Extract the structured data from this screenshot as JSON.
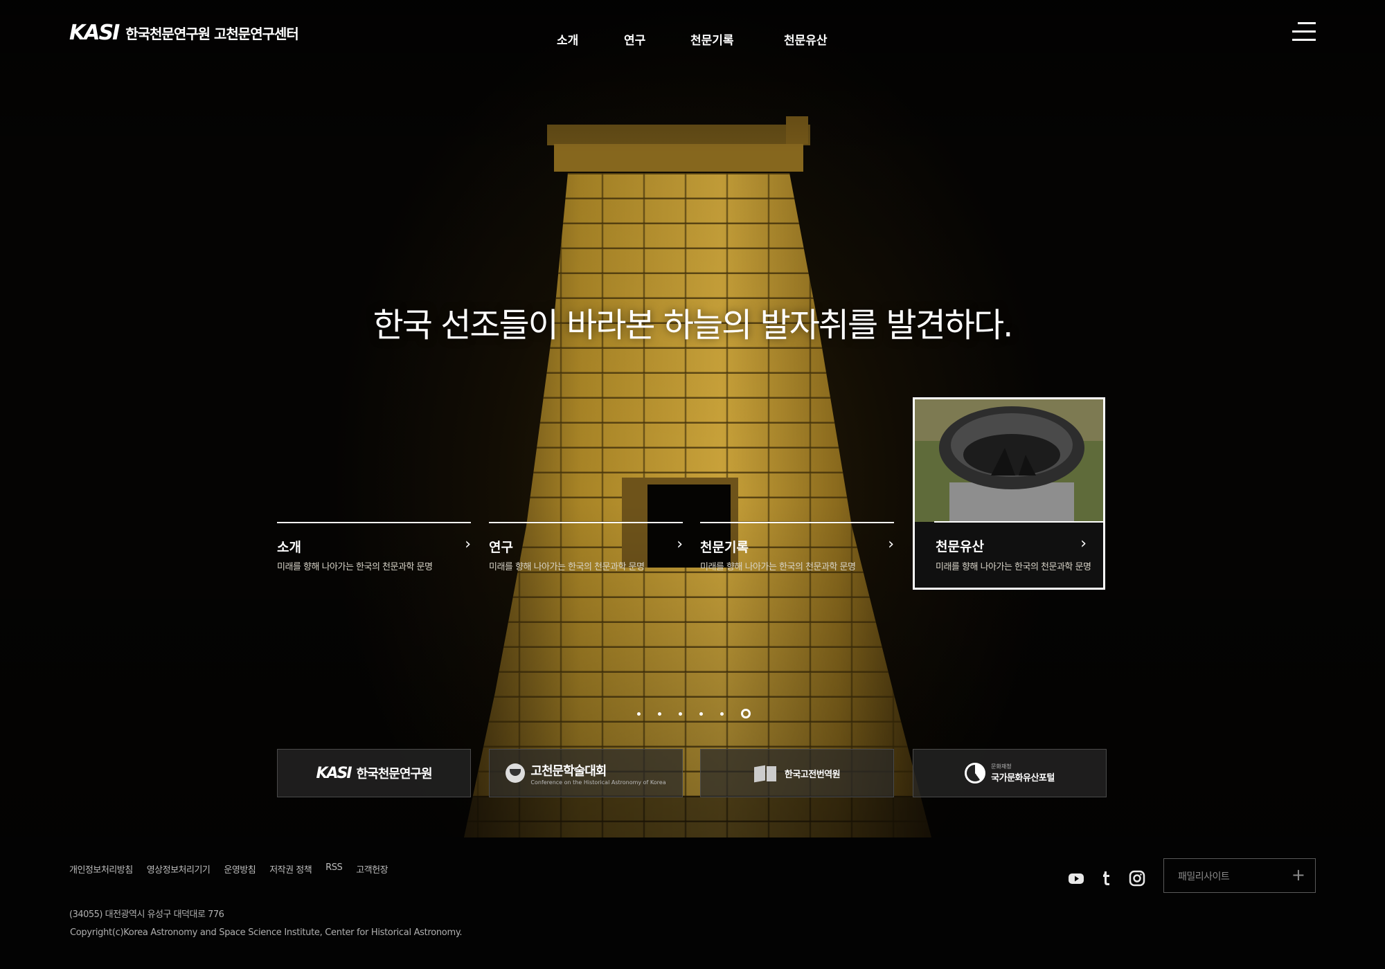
{
  "header": {
    "logo_mark": "KASI",
    "logo_text": "한국천문연구원 고천문연구센터",
    "nav": [
      "소개",
      "연구",
      "천문기록",
      "천문유산"
    ],
    "menu_icon": "hamburger-icon"
  },
  "hero": {
    "headline": "한국 선조들이 바라본 하늘의 발자취를 발견하다."
  },
  "cards": [
    {
      "title": "소개",
      "desc": "미래를 향해 나아가는 한국의 천문과학 문명"
    },
    {
      "title": "연구",
      "desc": "미래를 향해 나아가는 한국의 천문과학 문명"
    },
    {
      "title": "천문기록",
      "desc": "미래를 향해 나아가는 한국의 천문과학 문명"
    },
    {
      "title": "천문유산",
      "desc": "미래를 향해 나아가는 한국의 천문과학 문명"
    }
  ],
  "arrow_glyph": "›",
  "pagination": {
    "count": 6,
    "active": 6
  },
  "banners": [
    {
      "mark": "KASI",
      "text": "한국천문연구원"
    },
    {
      "text": "고천문학술대회",
      "sub": "Conference on the Historical Astronomy of Korea"
    },
    {
      "text": "한국고전번역원"
    },
    {
      "sub": "문화재청",
      "text": "국가문화유산포털"
    }
  ],
  "footer": {
    "links": [
      "개인정보처리방침",
      "영상정보처리기기",
      "운영방침",
      "저작권 정책",
      "RSS",
      "고객헌장"
    ],
    "address": "(34055) 대전광역시 유성구 대덕대로 776",
    "copyright": "Copyright(c)Korea Astronomy and Space Science Institute, Center for Historical Astronomy.",
    "sns": [
      "youtube-icon",
      "tumblr-icon",
      "instagram-icon"
    ],
    "family_site": "패밀리사이트",
    "family_plus": "+"
  },
  "colors": {
    "background": "#000000",
    "text": "#ffffff",
    "tower_light": "#c9a23a",
    "tower_dark": "#5e4613"
  }
}
